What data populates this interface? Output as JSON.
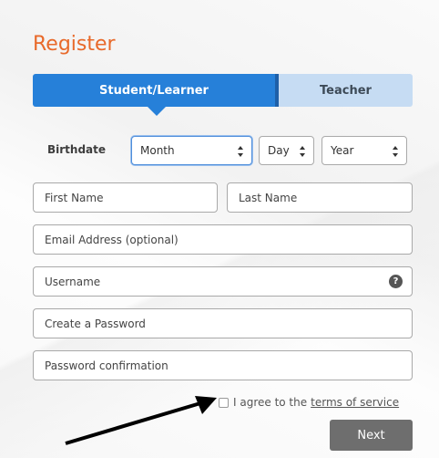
{
  "page": {
    "title": "Register"
  },
  "tabs": [
    {
      "label": "Student/Learner",
      "active": true
    },
    {
      "label": "Teacher",
      "active": false
    }
  ],
  "birthdate": {
    "label": "Birthdate",
    "month": "Month",
    "day": "Day",
    "year": "Year"
  },
  "fields": {
    "first_name": {
      "placeholder": "First Name"
    },
    "last_name": {
      "placeholder": "Last Name"
    },
    "email": {
      "placeholder": "Email Address (optional)"
    },
    "username": {
      "placeholder": "Username",
      "help": "?"
    },
    "password": {
      "placeholder": "Create a Password"
    },
    "password_confirm": {
      "placeholder": "Password confirmation"
    }
  },
  "agree": {
    "text": "I agree to the",
    "link": "terms of service",
    "checked": false
  },
  "buttons": {
    "next": "Next"
  },
  "colors": {
    "title": "#e8692a",
    "tab_active": "#2680d9",
    "tab_inactive": "#c6dcf3",
    "button": "#6e6e6e"
  }
}
